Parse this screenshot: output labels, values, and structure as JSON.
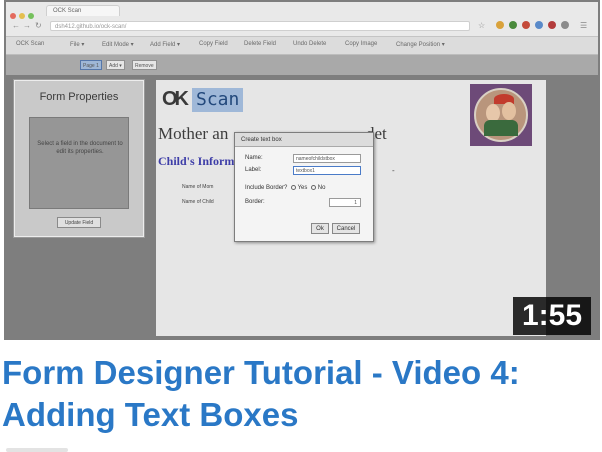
{
  "browser": {
    "tab_title": "OCK Scan",
    "url": "dsh412.github.io/ock-scan/"
  },
  "app_menu": [
    "OCK Scan",
    "File ▾",
    "Edit Mode ▾",
    "Add Field ▾",
    "Copy Field",
    "Delete Field",
    "Undo Delete",
    "Copy Image",
    "Change Position ▾"
  ],
  "page_bar": {
    "buttons": [
      "Page 1",
      "Add ▾",
      "Remove"
    ]
  },
  "form_properties": {
    "title": "Form Properties",
    "hint": "Select a field in the document to edit its properties.",
    "update_button": "Update Field"
  },
  "document": {
    "logo_mark": "OK",
    "logo_text": "Scan",
    "title_left": "Mother an",
    "title_right": "det",
    "section": "Child's Inform",
    "field_labels": [
      "Name of Mom",
      "Name of Child"
    ],
    "dash": "-"
  },
  "dialog": {
    "title": "Create text box",
    "name_label": "Name:",
    "name_value": "nameofchildstbox",
    "label_label": "Label:",
    "label_value": "textbox1",
    "border_question": "Include Border?",
    "yes_label": "Yes",
    "no_label": "No",
    "border_label": "Border:",
    "border_value": "1",
    "ok_label": "Ok",
    "cancel_label": "Cancel"
  },
  "video": {
    "duration": "1:55",
    "title": "Form Designer Tutorial - Video 4: Adding Text Boxes"
  },
  "colors": {
    "title_blue": "#2a78c6",
    "duration_bg": "#000000",
    "dialog_bg": "#f4f4f4",
    "section_blue": "#3e3ea8"
  },
  "icons": [
    "back-arrow-icon",
    "forward-arrow-icon",
    "reload-icon",
    "star-icon",
    "menu-icon"
  ]
}
